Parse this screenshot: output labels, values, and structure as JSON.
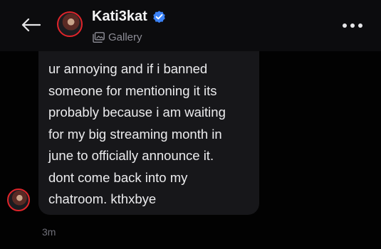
{
  "header": {
    "back_icon": "arrow-left-icon",
    "name": "Kati3kat",
    "verified_icon": "verified-badge-icon",
    "gallery_icon": "gallery-icon",
    "gallery_label": "Gallery",
    "more_icon": "more-horizontal-icon"
  },
  "message": {
    "text": "ur annoying and if i banned\nsomeone for mentioning it its\nprobably because i am waiting\nfor my big streaming month in\njune to officially announce it.\ndont come back into my\nchatroom. kthxbye",
    "timestamp": "3m"
  },
  "colors": {
    "background": "#020202",
    "bubble": "#17171a",
    "verified": "#3b82f6",
    "avatar_ring": "#e0242a"
  }
}
